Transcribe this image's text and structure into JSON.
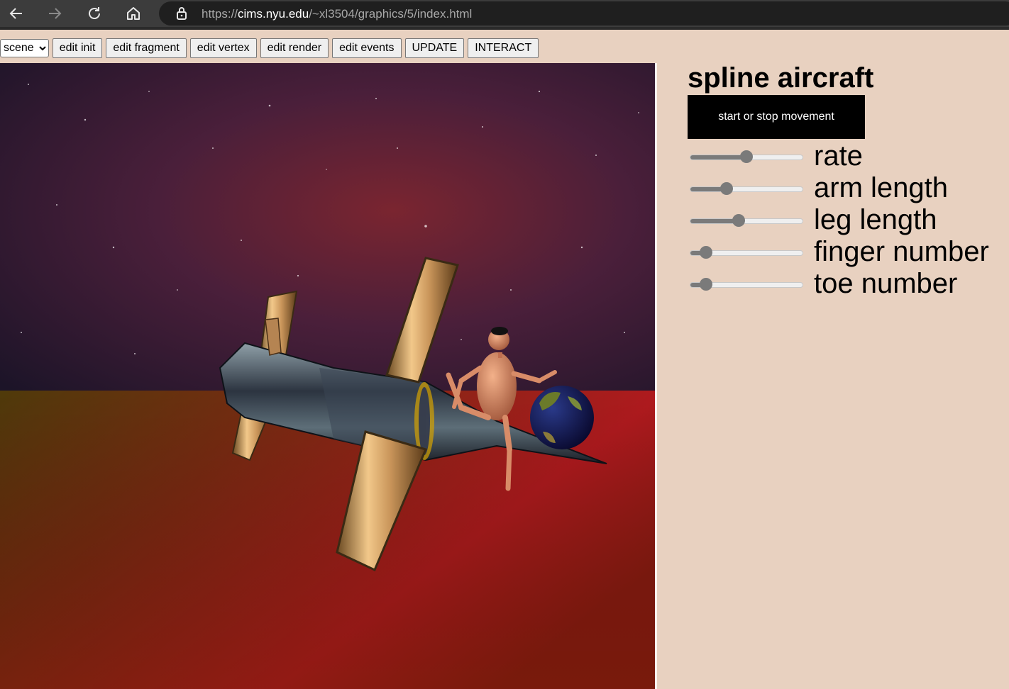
{
  "browser": {
    "url_prefix": "https://",
    "url_host": "cims.nyu.edu",
    "url_path": "/~xl3504/graphics/5/index.html"
  },
  "toolbar": {
    "select_value": "scene",
    "buttons": [
      "edit init",
      "edit fragment",
      "edit vertex",
      "edit render",
      "edit events",
      "UPDATE",
      "INTERACT"
    ]
  },
  "panel": {
    "title": "spline aircraft",
    "move_button": "start or stop movement",
    "sliders": [
      {
        "label": "rate",
        "value": 0.5
      },
      {
        "label": "arm length",
        "value": 0.3
      },
      {
        "label": "leg length",
        "value": 0.42
      },
      {
        "label": "finger number",
        "value": 0.1
      },
      {
        "label": "toe number",
        "value": 0.1
      }
    ]
  },
  "colors": {
    "page_bg": "#e8d1c0",
    "slider_fill": "#7a7a7a",
    "button_bg": "#000000"
  }
}
